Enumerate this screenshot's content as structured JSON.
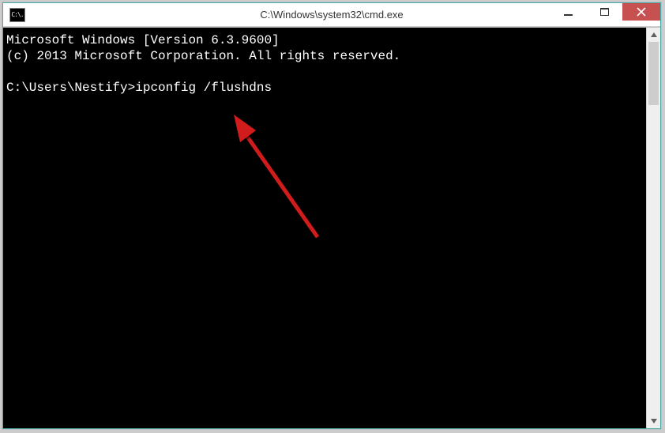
{
  "window": {
    "title": "C:\\Windows\\system32\\cmd.exe",
    "sysicon_glyph": "C:\\."
  },
  "console": {
    "line1": "Microsoft Windows [Version 6.3.9600]",
    "line2": "(c) 2013 Microsoft Corporation. All rights reserved.",
    "blank": "",
    "prompt": "C:\\Users\\Nestify>",
    "command": "ipconfig /flushdns"
  },
  "controls": {
    "minimize_label": "Minimize",
    "maximize_label": "Maximize",
    "close_label": "Close",
    "scroll_up_label": "Scroll up",
    "scroll_down_label": "Scroll down"
  },
  "annotation": {
    "arrow_color": "#d11b1b"
  }
}
